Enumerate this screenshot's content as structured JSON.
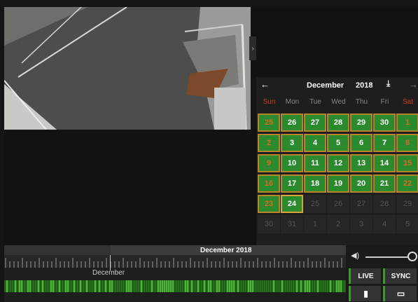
{
  "calendar": {
    "back_icon": "←",
    "forward_icon": "→",
    "download_icon": "⤓",
    "month": "December",
    "year": "2018",
    "weekdays": [
      "Sun",
      "Mon",
      "Tue",
      "Wed",
      "Thu",
      "Fri",
      "Sat"
    ],
    "weeks": [
      [
        "25",
        "26",
        "27",
        "28",
        "29",
        "30",
        "1"
      ],
      [
        "2",
        "3",
        "4",
        "5",
        "6",
        "7",
        "8"
      ],
      [
        "9",
        "10",
        "11",
        "12",
        "13",
        "14",
        "15"
      ],
      [
        "16",
        "17",
        "18",
        "19",
        "20",
        "21",
        "22"
      ],
      [
        "23",
        "24",
        "25",
        "26",
        "27",
        "28",
        "29"
      ],
      [
        "30",
        "31",
        "1",
        "2",
        "3",
        "4",
        "5"
      ]
    ],
    "recorded_through": "24",
    "colors": {
      "recorded": "#2c8a2e",
      "recorded_border": "#b8862a",
      "weekend_label": "#d23a1e"
    }
  },
  "timeline": {
    "title": "December 2018",
    "label": "December"
  },
  "controls": {
    "volume_icon": "volume-icon",
    "volume_glyph": "◀)",
    "live_label": "LIVE",
    "sync_label": "SYNC",
    "bookmark_glyph": "▮",
    "calendar_glyph": "▭"
  },
  "collapse_glyph": "›"
}
